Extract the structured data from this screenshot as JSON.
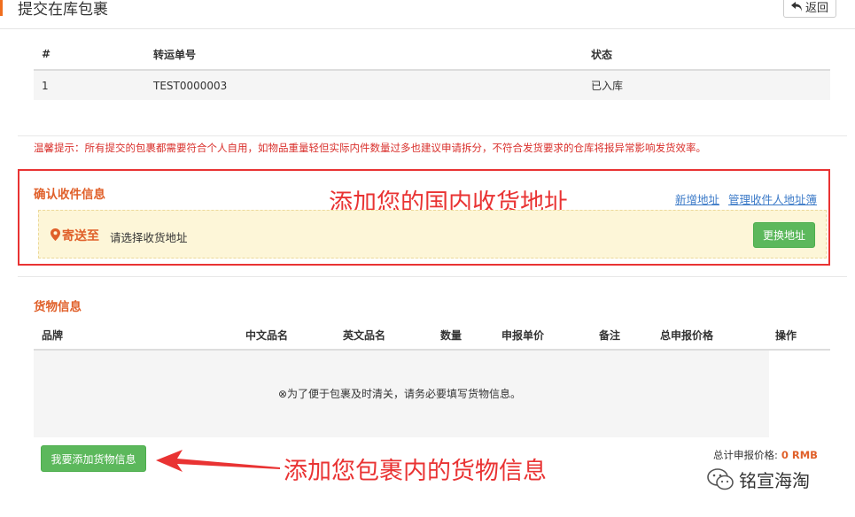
{
  "header": {
    "title": "提交在库包裹",
    "back_label": "返回"
  },
  "parcels": {
    "columns": [
      "#",
      "转运单号",
      "状态"
    ],
    "rows": [
      {
        "index": "1",
        "tracking_no": "TEST0000003",
        "status": "已入库"
      }
    ]
  },
  "tip": "温馨提示：所有提交的包裹都需要符合个人自用，如物品重量轻但实际内件数量过多也建议申请拆分，不符合发货要求的仓库将报异常影响发货效率。",
  "recipient": {
    "title": "确认收件信息",
    "annotation": "添加您的国内收货地址",
    "new_address": "新增地址",
    "manage_address": "管理收件人地址簿",
    "send_to_label": "寄送至",
    "address_placeholder": "请选择收货地址",
    "change_address": "更换地址"
  },
  "goods": {
    "title": "货物信息",
    "columns": [
      "品牌",
      "中文品名",
      "英文品名",
      "数量",
      "申报单价",
      "备注",
      "总申报价格",
      "操作"
    ],
    "empty_message": "⊗为了便于包裹及时清关，请务必要填写货物信息。",
    "add_button": "我要添加货物信息",
    "annotation": "添加您包裹内的货物信息",
    "total_label": "总计申报价格:",
    "total_value": "0 RMB"
  },
  "watermark": {
    "text": "铭宣海淘",
    "icon": "wechat-icon"
  },
  "colors": {
    "accent": "#e0602a",
    "danger": "#e93333",
    "success": "#5cb85c",
    "link": "#3d7bc8"
  }
}
